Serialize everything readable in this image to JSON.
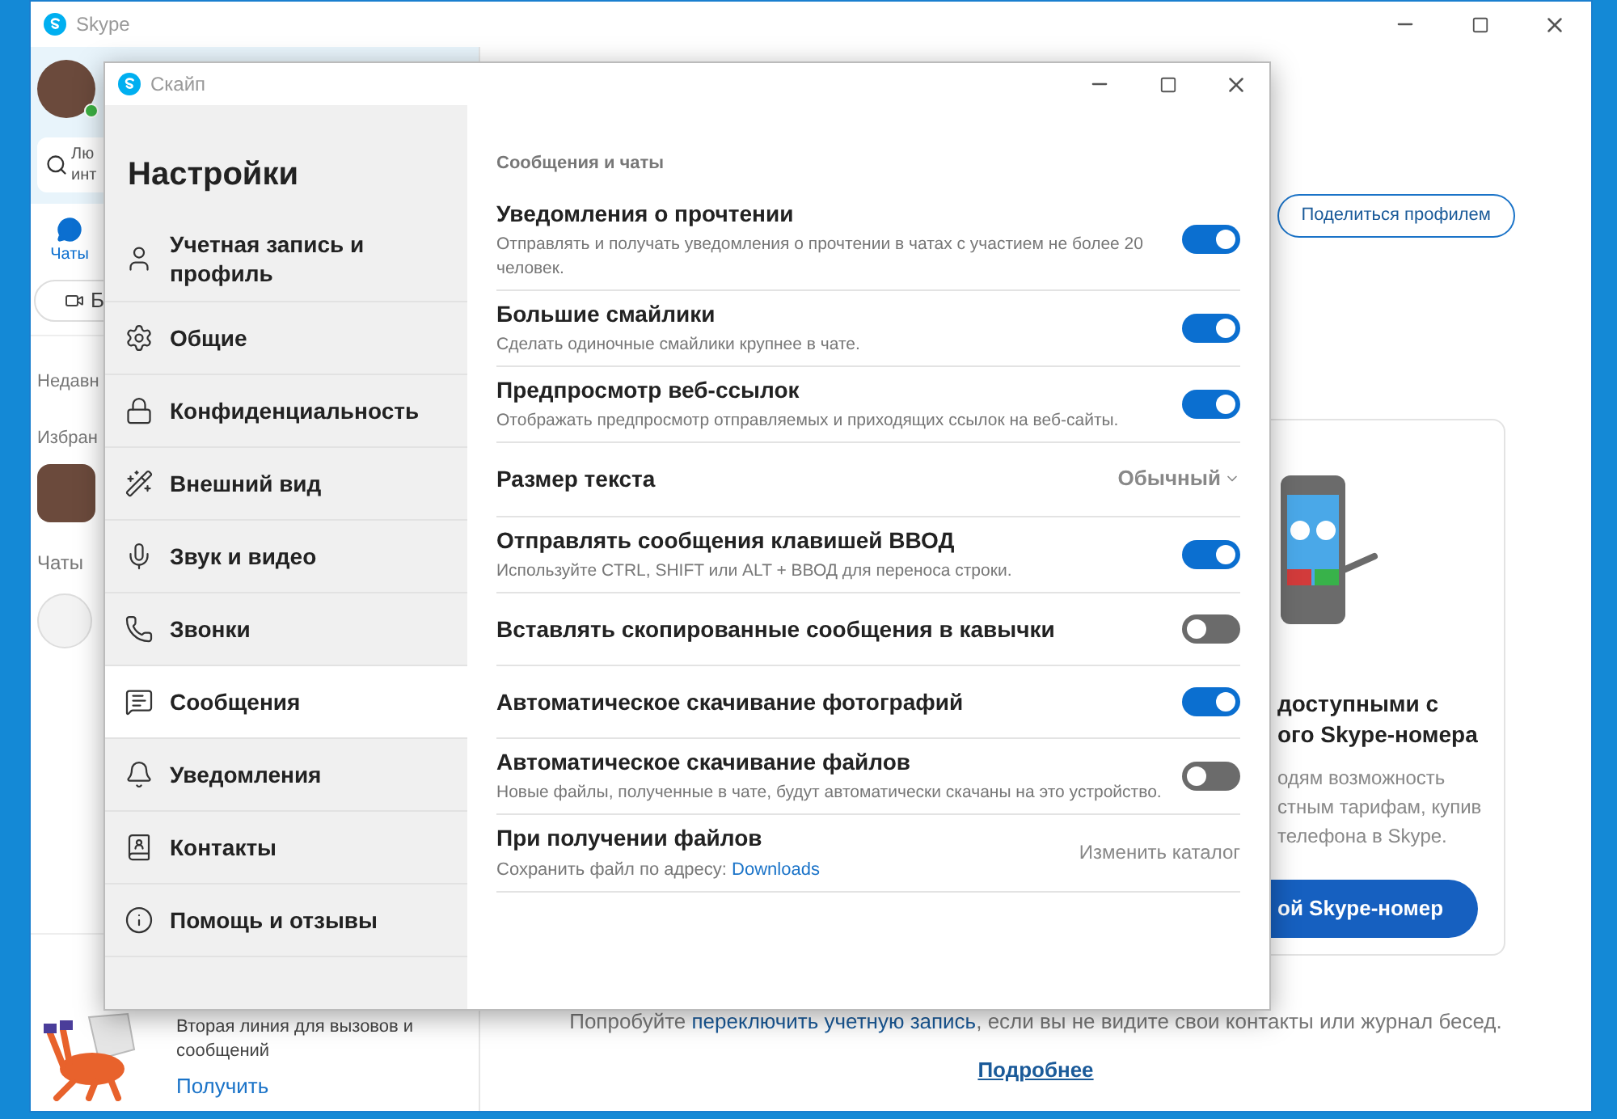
{
  "main_window": {
    "title": "Skype",
    "search": {
      "placeholder_line_1": "Лю",
      "placeholder_line_2": "инт"
    },
    "nav_tab": {
      "label": "Чаты",
      "selected": true
    },
    "pill_button": {
      "label": "Б"
    },
    "sections": [
      "Недавн",
      "Избран",
      "Чаты"
    ],
    "promo": {
      "text": "Вторая линия для вызовов и сообщений",
      "link": "Получить"
    },
    "share_button": "Поделиться профилем",
    "card": {
      "title_lines": [
        "доступными с",
        "ого Skype-номера"
      ],
      "body_lines": [
        "одям возможность",
        "стным тарифам, купив",
        "телефона в Skype."
      ],
      "button": "ой Skype-номер"
    },
    "footer": {
      "text": "Попробуйте **переключить учетную запись**, если вы не видите свои контакты или журнал бесед.",
      "link": "Подробнее"
    }
  },
  "dialog": {
    "title": "Скайп",
    "heading": "Настройки",
    "nav": [
      {
        "label": "Учетная запись и профиль",
        "selected": false
      },
      {
        "label": "Общие",
        "selected": false
      },
      {
        "label": "Конфиденциальность",
        "selected": false
      },
      {
        "label": "Внешний вид",
        "selected": false
      },
      {
        "label": "Звук и видео",
        "selected": false
      },
      {
        "label": "Звонки",
        "selected": false
      },
      {
        "label": "Сообщения",
        "selected": true
      },
      {
        "label": "Уведомления",
        "selected": false
      },
      {
        "label": "Контакты",
        "selected": false
      },
      {
        "label": "Помощь и отзывы",
        "selected": false
      }
    ],
    "section_title": "Сообщения и чаты",
    "settings": [
      {
        "kind": "toggle",
        "title": "Уведомления о прочтении",
        "description": "Отправлять и получать уведомления о прочтении в чатах с участием не более 20 человек.",
        "on": true
      },
      {
        "kind": "toggle",
        "title": "Большие смайлики",
        "description": "Сделать одиночные смайлики крупнее в чате.",
        "on": true
      },
      {
        "kind": "toggle",
        "title": "Предпросмотр веб-ссылок",
        "description": "Отображать предпросмотр отправляемых и приходящих ссылок на веб-сайты.",
        "on": true
      },
      {
        "kind": "dropdown",
        "title": "Размер текста",
        "value": "Обычный"
      },
      {
        "kind": "toggle",
        "title": "Отправлять сообщения клавишей ВВОД",
        "description": "Используйте CTRL, SHIFT или ALT + ВВОД для переноса строки.",
        "on": true
      },
      {
        "kind": "toggle",
        "title": "Вставлять скопированные сообщения в кавычки",
        "on": false
      },
      {
        "kind": "toggle",
        "title": "Автоматическое скачивание фотографий",
        "on": true
      },
      {
        "kind": "toggle",
        "title": "Автоматическое скачивание файлов",
        "description": "Новые файлы, полученные в чате, будут автоматически скачаны на это устройство.",
        "on": false
      },
      {
        "kind": "folder",
        "title": "При получении файлов",
        "description": "Сохранить файл по адресу:",
        "link": "Downloads",
        "action": "Изменить каталог"
      }
    ]
  }
}
